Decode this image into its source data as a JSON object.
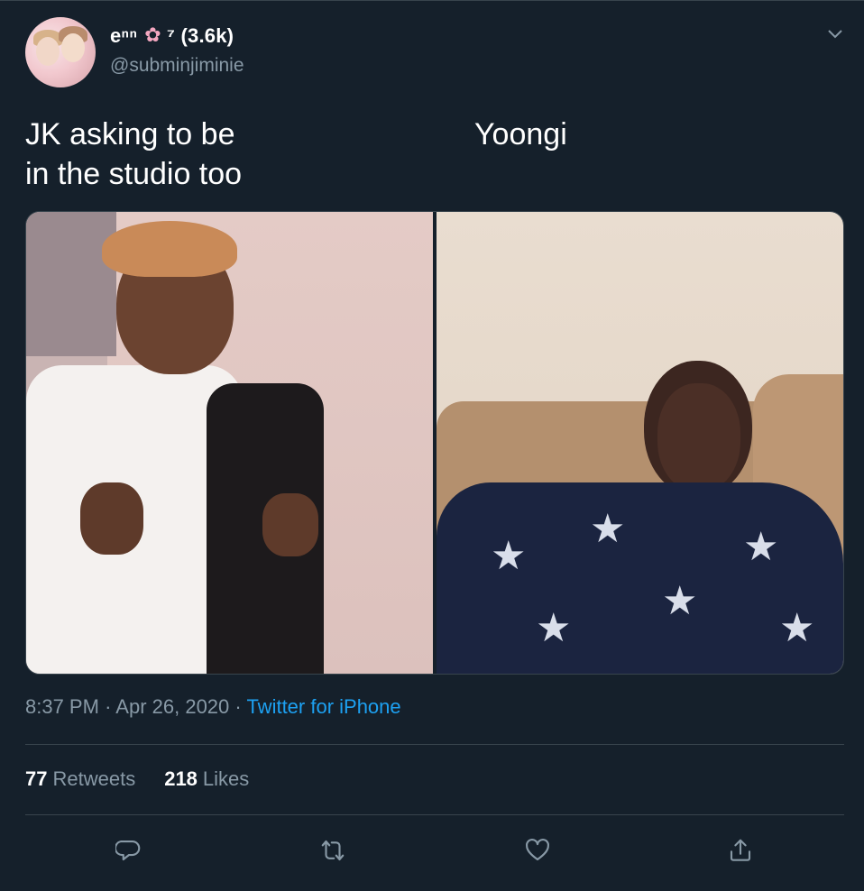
{
  "author": {
    "display_name": "eⁿⁿ",
    "name_suffix": "⁷ (3.6k)",
    "handle": "@subminjiminie"
  },
  "tweet": {
    "caption_left": [
      "JK asking to be",
      "in the studio too"
    ],
    "caption_right": "Yoongi",
    "time": "8:37 PM",
    "date": "Apr 26, 2020",
    "source": "Twitter for iPhone"
  },
  "stats": {
    "retweets_count": "77",
    "retweets_label": "Retweets",
    "likes_count": "218",
    "likes_label": "Likes"
  },
  "icons": {
    "caret": "chevron-down-icon",
    "reply": "reply-icon",
    "retweet": "retweet-icon",
    "like": "heart-icon",
    "share": "share-icon"
  },
  "colors": {
    "background": "#15202b",
    "accent": "#1da1f2",
    "secondary_text": "#8899a6",
    "divider": "#38444d"
  }
}
